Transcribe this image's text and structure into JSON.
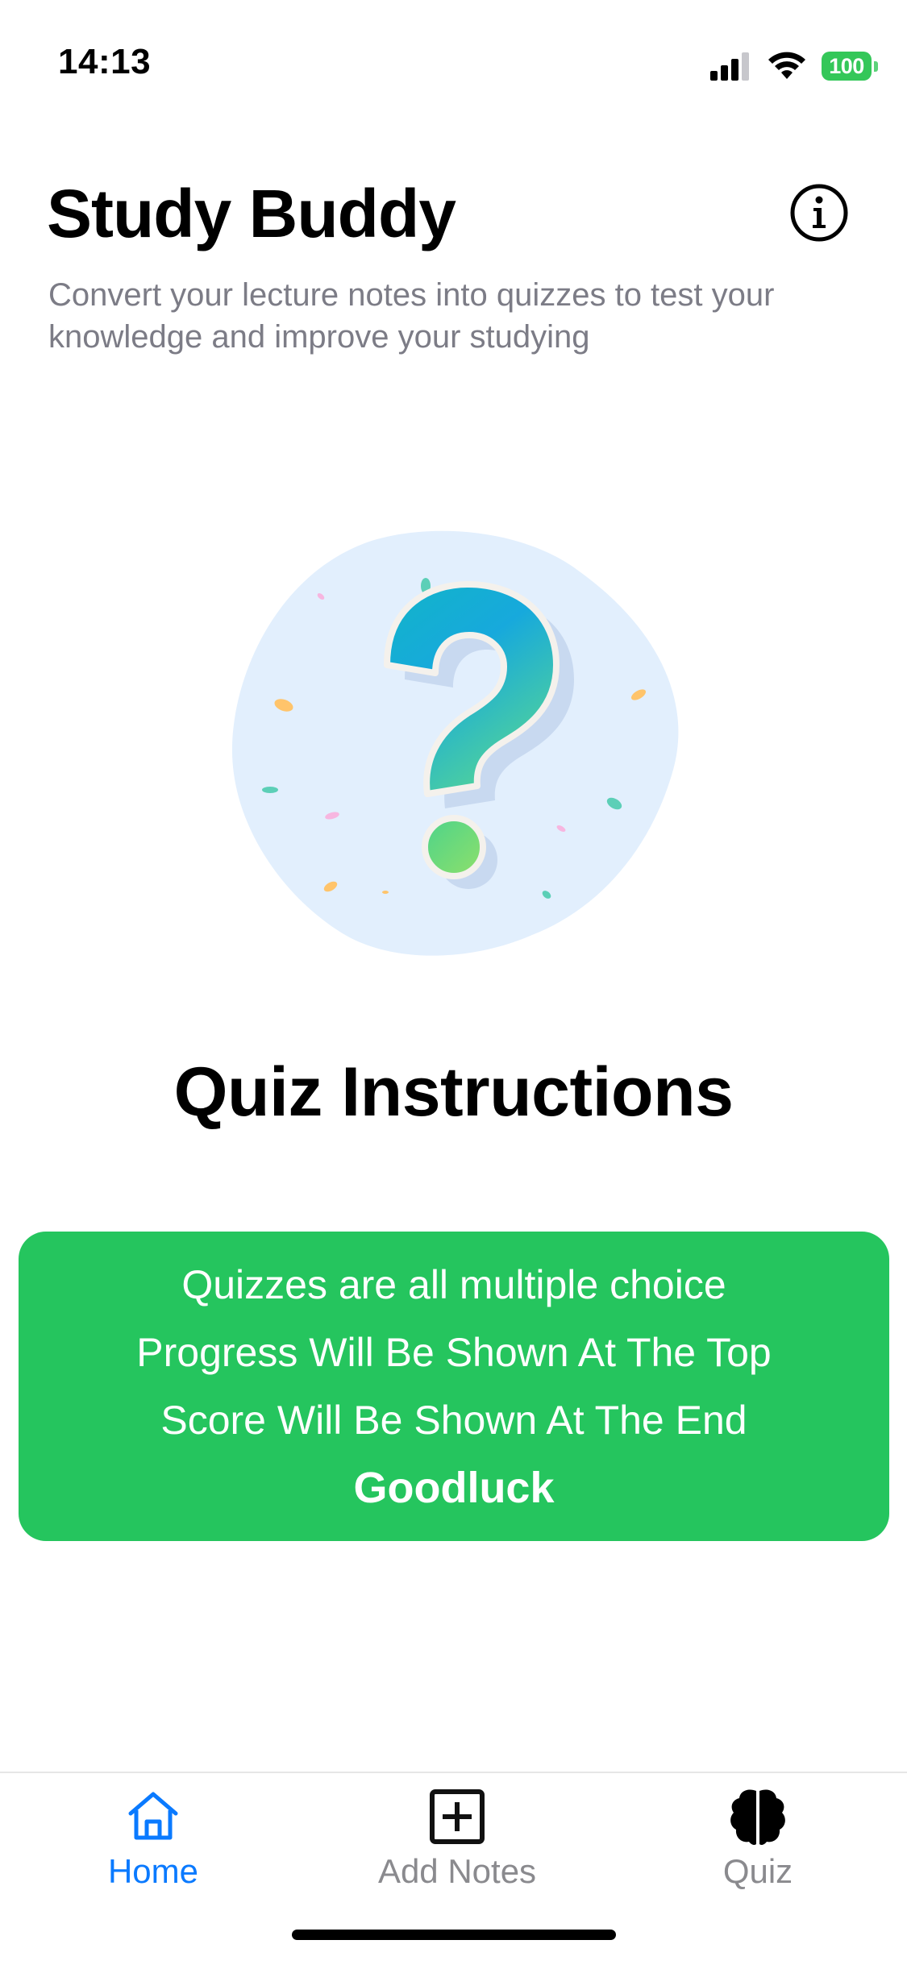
{
  "status_bar": {
    "time": "14:13",
    "battery_level": "100",
    "icons": [
      "signal-icon",
      "wifi-icon",
      "battery-icon"
    ]
  },
  "header": {
    "title": "Study Buddy",
    "subtitle": "Convert your lecture notes into quizzes to test your knowledge and improve your studying",
    "info_icon": "info-circle-icon"
  },
  "illustration": {
    "icon": "question-mark-illustration"
  },
  "instructions": {
    "heading": "Quiz Instructions",
    "lines": [
      "Quizzes are all multiple choice",
      "Progress Will Be Shown At The Top",
      "Score Will Be Shown At The End"
    ],
    "closing": "Goodluck"
  },
  "tab_bar": {
    "tabs": [
      {
        "label": "Home",
        "icon": "house-icon",
        "selected": true
      },
      {
        "label": "Add Notes",
        "icon": "plus-square-icon",
        "selected": false
      },
      {
        "label": "Quiz",
        "icon": "brain-icon",
        "selected": false
      }
    ]
  },
  "colors": {
    "accent": "#0a7aff",
    "card_green": "#25c55e",
    "battery_green": "#34c759",
    "subtitle_gray": "#7c7c86",
    "tab_inactive": "#8a8a8e"
  }
}
